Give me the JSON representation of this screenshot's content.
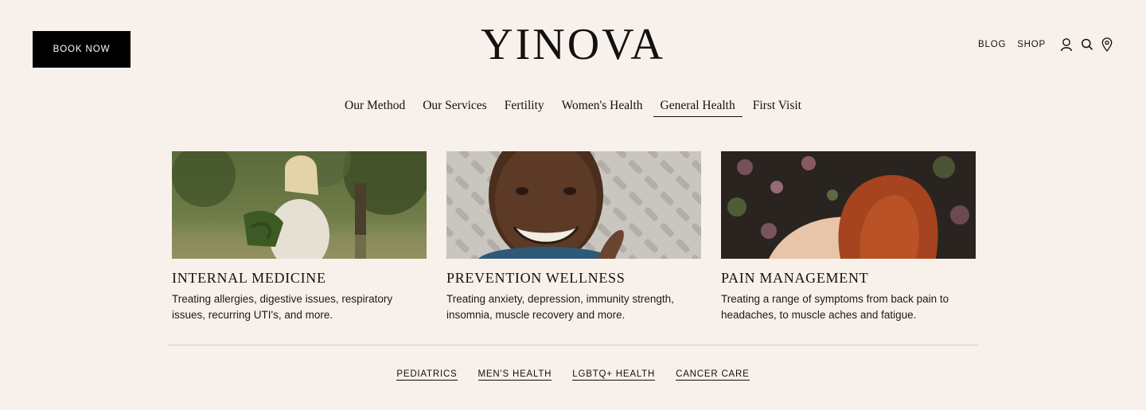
{
  "header": {
    "book_button": "BOOK NOW",
    "logo": "YINOVA",
    "util_links": [
      "BLOG",
      "SHOP"
    ],
    "icons": [
      "account-icon",
      "search-icon",
      "location-pin-icon"
    ]
  },
  "nav": {
    "items": [
      "Our Method",
      "Our Services",
      "Fertility",
      "Women's Health",
      "General Health",
      "First Visit"
    ],
    "active": "General Health"
  },
  "cards": [
    {
      "title": "INTERNAL MEDICINE",
      "description": "Treating allergies, digestive issues, respiratory issues, recurring UTI's, and more."
    },
    {
      "title": "PREVENTION WELLNESS",
      "description": "Treating anxiety, depression, immunity strength, insomnia, muscle recovery and more."
    },
    {
      "title": "PAIN MANAGEMENT",
      "description": "Treating a range of symptoms from back pain to headaches, to muscle aches and fatigue."
    }
  ],
  "sub_links": [
    "PEDIATRICS",
    "MEN'S HEALTH",
    "LGBTQ+ HEALTH",
    "CANCER CARE"
  ],
  "colors": {
    "background": "#f8f0eb",
    "text": "#111111",
    "button": "#000000"
  }
}
